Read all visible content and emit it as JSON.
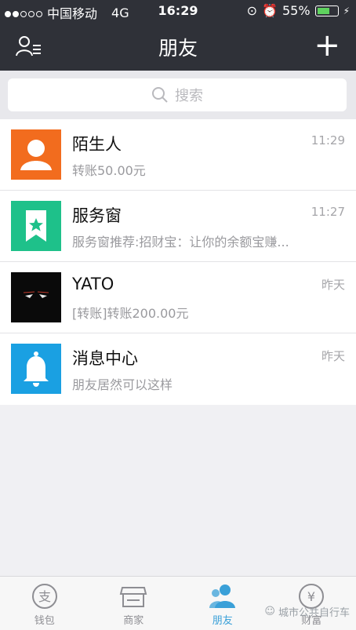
{
  "status_bar": {
    "carrier": "中国移动",
    "network": "4G",
    "time": "16:29",
    "battery": "55%"
  },
  "header": {
    "title": "朋友"
  },
  "search": {
    "placeholder": "搜索"
  },
  "conversations": [
    {
      "name": "陌生人",
      "preview": "转账50.00元",
      "time": "11:29",
      "avatar_icon": "person-icon",
      "color": "#f26c1e"
    },
    {
      "name": "服务窗",
      "preview": "服务窗推荐:招财宝：让你的余额宝赚...",
      "time": "11:27",
      "avatar_icon": "star-bookmark-icon",
      "color": "#1ec18a"
    },
    {
      "name": "YATO",
      "preview": "[转账]转账200.00元",
      "time": "昨天",
      "avatar_icon": "dark-photo-avatar",
      "color": "#111111"
    },
    {
      "name": "消息中心",
      "preview": "朋友居然可以这样",
      "time": "昨天",
      "avatar_icon": "bell-icon",
      "color": "#1aa0e2"
    }
  ],
  "tabs": [
    {
      "label": "钱包",
      "icon": "wallet-icon"
    },
    {
      "label": "商家",
      "icon": "store-icon"
    },
    {
      "label": "朋友",
      "icon": "friends-icon",
      "active": true
    },
    {
      "label": "财富",
      "icon": "yen-icon"
    }
  ],
  "watermark": {
    "text": "城市公共自行车"
  },
  "colors": {
    "nav_bg": "#2f3138",
    "accent": "#3aa0d8"
  }
}
